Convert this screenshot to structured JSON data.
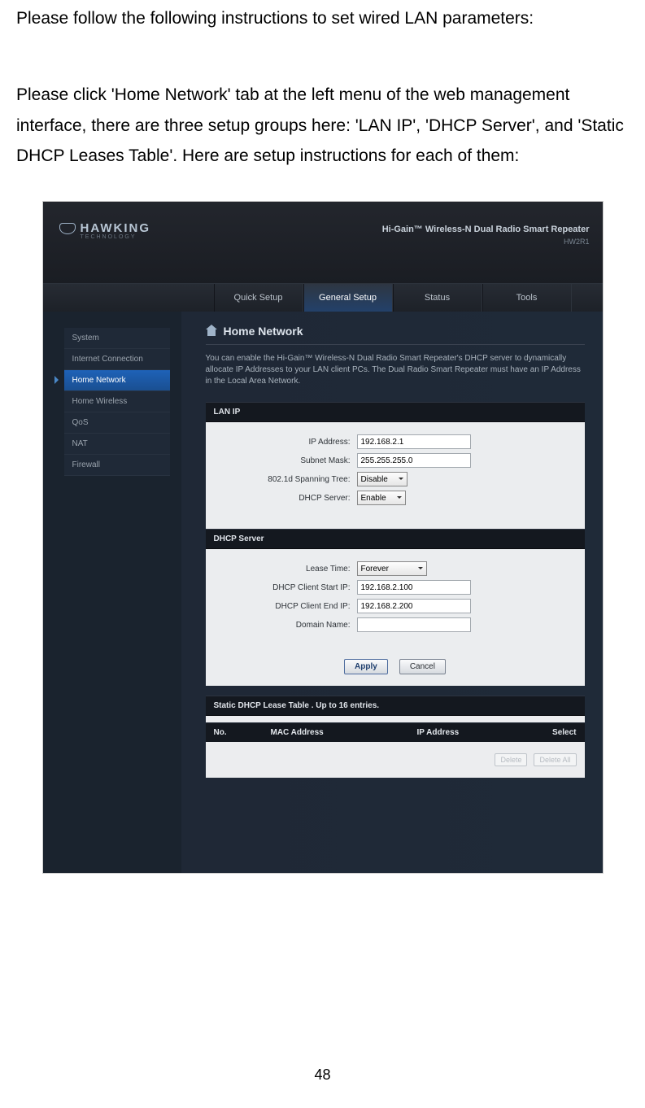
{
  "doc": {
    "intro1": "Please follow the following instructions to set wired LAN parameters:",
    "intro2": "Please click 'Home Network' tab at the left menu of the web management interface, there are three setup groups here: 'LAN IP', 'DHCP Server', and 'Static DHCP Leases Table'. Here are setup instructions for each of them:",
    "pageNumber": "48"
  },
  "header": {
    "brand": "HAWKING",
    "brandSub": "TECHNOLOGY",
    "productTitle": "Hi-Gain™ Wireless-N Dual Radio Smart Repeater",
    "productModel": "HW2R1"
  },
  "topnav": {
    "items": [
      "Quick Setup",
      "General Setup",
      "Status",
      "Tools"
    ],
    "activeIndex": 1
  },
  "sidebar": {
    "items": [
      "System",
      "Internet Connection",
      "Home Network",
      "Home Wireless",
      "QoS",
      "NAT",
      "Firewall"
    ],
    "activeIndex": 2
  },
  "content": {
    "title": "Home Network",
    "desc": "You can enable the Hi-Gain™ Wireless-N Dual Radio Smart Repeater's DHCP server to dynamically allocate IP Addresses to your LAN client PCs. The Dual Radio Smart Repeater must have an IP Address in the Local Area Network.",
    "sections": {
      "lanip": {
        "header": "LAN IP",
        "fields": {
          "ip_label": "IP Address:",
          "ip_value": "192.168.2.1",
          "mask_label": "Subnet Mask:",
          "mask_value": "255.255.255.0",
          "stp_label": "802.1d Spanning Tree:",
          "stp_value": "Disable",
          "dhcp_label": "DHCP Server:",
          "dhcp_value": "Enable"
        }
      },
      "dhcp": {
        "header": "DHCP Server",
        "fields": {
          "lease_label": "Lease Time:",
          "lease_value": "Forever",
          "start_label": "DHCP Client Start IP:",
          "start_value": "192.168.2.100",
          "end_label": "DHCP Client End IP:",
          "end_value": "192.168.2.200",
          "domain_label": "Domain Name:",
          "domain_value": ""
        }
      },
      "static": {
        "header": "Static DHCP Lease Table . Up to 16 entries.",
        "cols": {
          "no": "No.",
          "mac": "MAC Address",
          "ip": "IP Address",
          "select": "Select"
        }
      }
    },
    "buttons": {
      "apply": "Apply",
      "cancel": "Cancel",
      "delete": "Delete",
      "deleteAll": "Delete All"
    }
  }
}
